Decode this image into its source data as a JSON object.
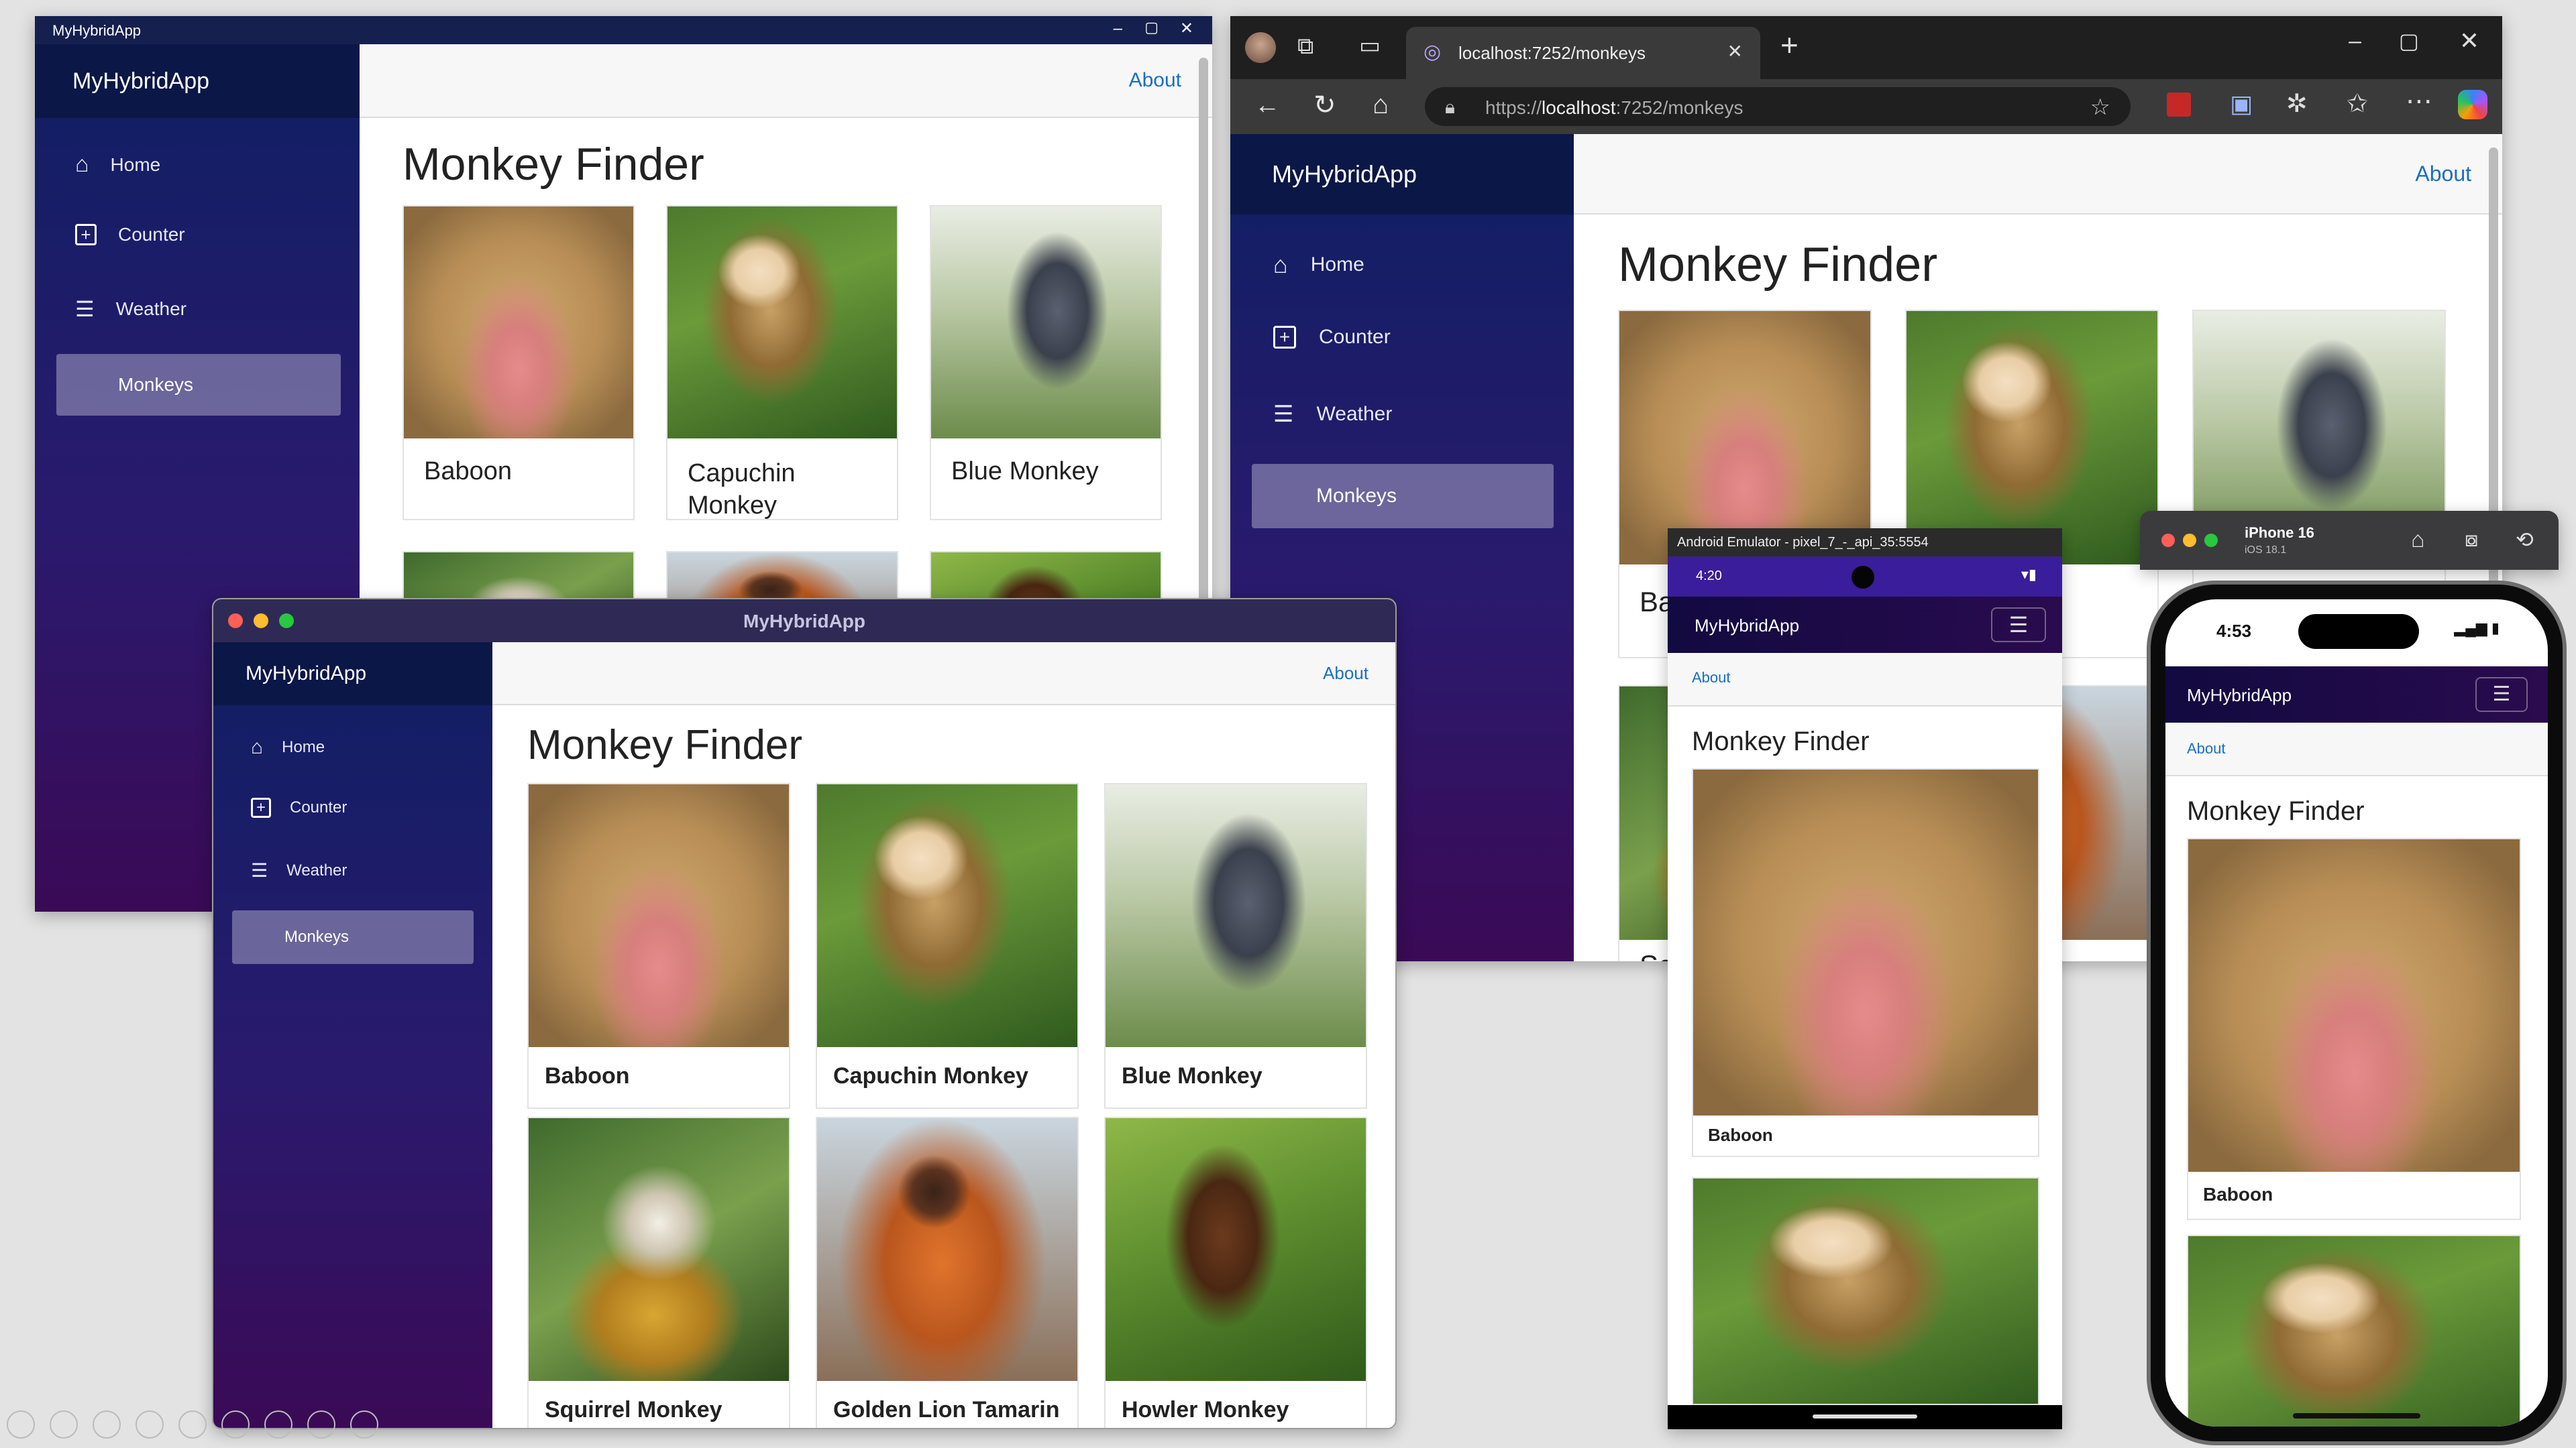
{
  "app_name": "MyHybridApp",
  "nav": {
    "home": "Home",
    "counter": "Counter",
    "weather": "Weather",
    "monkeys": "Monkeys"
  },
  "about": "About",
  "page_title": "Monkey Finder",
  "monkeys": [
    "Baboon",
    "Capuchin Monkey",
    "Blue Monkey",
    "Squirrel Monkey",
    "Golden Lion Tamarin",
    "Howler Monkey"
  ],
  "monkeys_wrapped": {
    "capuchin_line1": "Capuchin",
    "capuchin_line2": "Monkey"
  },
  "windows_win": {
    "title": "MyHybridApp"
  },
  "browser": {
    "tab_title": "localhost:7252/monkeys",
    "url_scheme": "https://",
    "url_host": "localhost",
    "url_rest": ":7252/monkeys",
    "partial_card": "Ba",
    "partial_card2": "Sc"
  },
  "mac_win": {
    "title": "MyHybridApp"
  },
  "android": {
    "title": "Android Emulator - pixel_7_-_api_35:5554",
    "time": "4:20"
  },
  "iphone": {
    "title": "iPhone 16",
    "subtitle": "iOS 18.1",
    "time": "4:53"
  },
  "colors": {
    "sidebar_top": "#0f1f63",
    "sidebar_bottom": "#3a0a56",
    "brand_bar": "#0b1746",
    "link": "#1a6fc2",
    "active_nav": "#8b86b5"
  }
}
